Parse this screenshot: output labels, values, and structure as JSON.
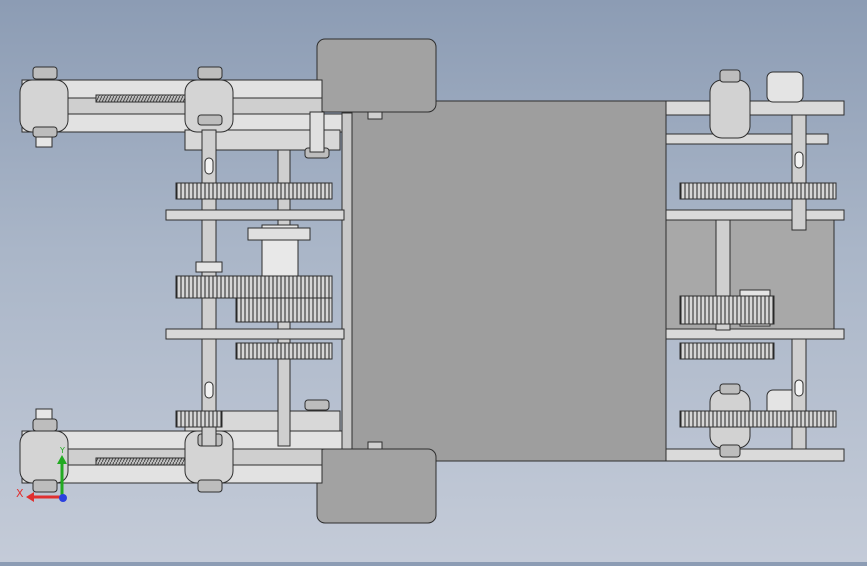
{
  "viewport": {
    "background_top": "#8c9cb4",
    "background_bottom": "#c4cbd8"
  },
  "model": {
    "metal_light": "#dcdcdc",
    "metal_mid": "#c0c0c0",
    "metal_dark": "#7a7a7a",
    "plate_gray": "#9e9e9e",
    "edge": "#2e2e2e"
  },
  "triad": {
    "x_label": "X",
    "y_label": "Y",
    "x_color": "#e03030",
    "y_color": "#22aa22",
    "z_color": "#2a40e0",
    "x_icon": "x-axis-arrow-icon",
    "y_icon": "y-axis-arrow-icon",
    "z_icon": "z-axis-dot-icon"
  }
}
